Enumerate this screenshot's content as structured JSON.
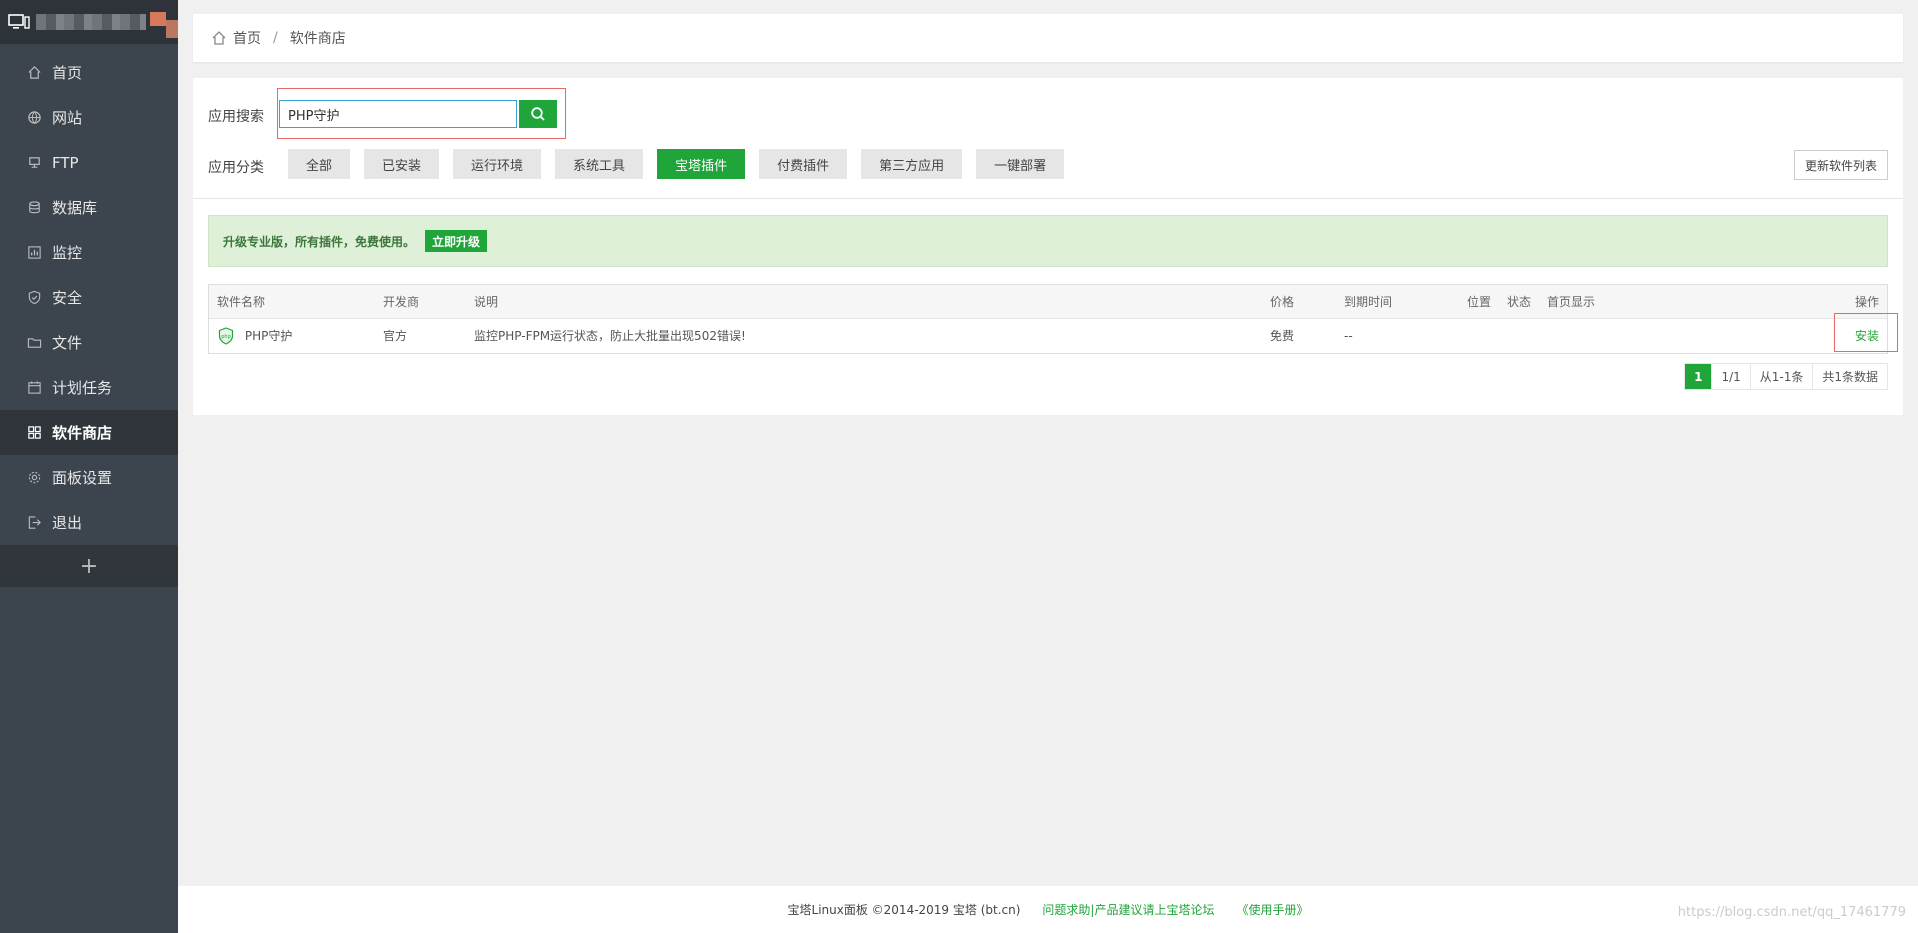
{
  "sidebar": {
    "items": [
      {
        "label": "首页",
        "icon": "home-icon"
      },
      {
        "label": "网站",
        "icon": "globe-icon"
      },
      {
        "label": "FTP",
        "icon": "ftp-icon"
      },
      {
        "label": "数据库",
        "icon": "database-icon"
      },
      {
        "label": "监控",
        "icon": "monitor-icon"
      },
      {
        "label": "安全",
        "icon": "shield-icon"
      },
      {
        "label": "文件",
        "icon": "folder-icon"
      },
      {
        "label": "计划任务",
        "icon": "calendar-icon"
      },
      {
        "label": "软件商店",
        "icon": "grid-icon",
        "active": true
      },
      {
        "label": "面板设置",
        "icon": "gear-icon"
      },
      {
        "label": "退出",
        "icon": "logout-icon"
      }
    ],
    "add_label": "+"
  },
  "breadcrumb": {
    "home": "首页",
    "separator": "/",
    "current": "软件商店"
  },
  "search": {
    "label": "应用搜索",
    "value": "PHP守护"
  },
  "categories": {
    "label": "应用分类",
    "items": [
      "全部",
      "已安装",
      "运行环境",
      "系统工具",
      "宝塔插件",
      "付费插件",
      "第三方应用",
      "一键部署"
    ],
    "active": "宝塔插件"
  },
  "refresh_label": "更新软件列表",
  "promo": {
    "text": "升级专业版，所有插件，免费使用。",
    "button": "立即升级"
  },
  "table": {
    "headers": [
      "软件名称",
      "开发商",
      "说明",
      "价格",
      "到期时间",
      "位置",
      "状态",
      "首页显示",
      "操作"
    ],
    "rows": [
      {
        "name": "PHP守护",
        "vendor": "官方",
        "desc": "监控PHP-FPM运行状态，防止大批量出现502错误!",
        "price": "免费",
        "expire": "--",
        "location": "",
        "status": "",
        "home": "",
        "action": "安装"
      }
    ]
  },
  "pager": {
    "current": "1",
    "pages": "1/1",
    "range": "从1-1条",
    "total": "共1条数据"
  },
  "footer": {
    "copyright": "宝塔Linux面板 ©2014-2019 宝塔 (bt.cn)",
    "forum": "问题求助|产品建议请上宝塔论坛",
    "manual": "《使用手册》"
  },
  "watermark": "https://blog.csdn.net/qq_17461779",
  "colors": {
    "accent": "#20a53a",
    "sidebar": "#3c444d",
    "highlight": "#e46a6a"
  }
}
